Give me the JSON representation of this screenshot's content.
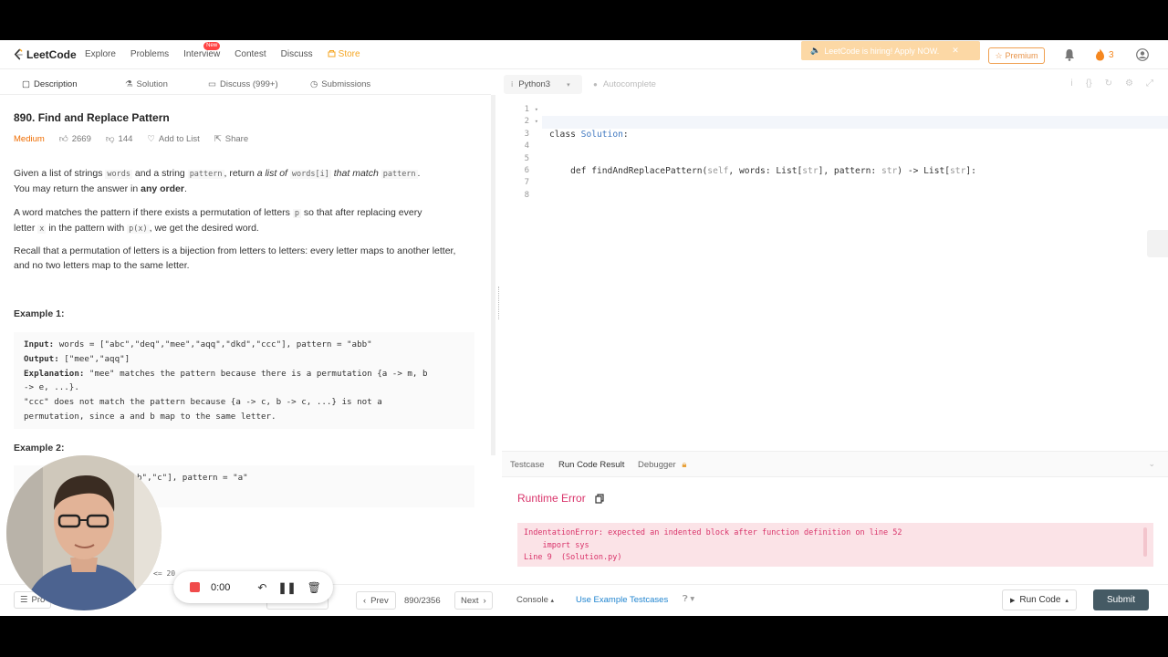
{
  "nav": {
    "logo": "LeetCode",
    "items": [
      "Explore",
      "Problems",
      "Interview",
      "Contest",
      "Discuss",
      "Store"
    ],
    "new_badge": "New",
    "hiring_banner": "LeetCode is hiring! Apply NOW.",
    "premium": "Premium",
    "streak": "3"
  },
  "left_tabs": {
    "description": "Description",
    "solution": "Solution",
    "discuss": "Discuss (999+)",
    "submissions": "Submissions"
  },
  "problem": {
    "title": "890. Find and Replace Pattern",
    "difficulty": "Medium",
    "likes": "2669",
    "dislikes": "144",
    "add_to_list": "Add to List",
    "share": "Share",
    "p1": {
      "a": "Given a list of strings",
      "b": "words",
      "c": "and a string",
      "d": "pattern",
      "e": ", return",
      "f": "a list of",
      "g": "words[i]",
      "h": "that match",
      "i": "pattern",
      "j": ".",
      "k": "You may return the answer in",
      "l": "any order",
      "m": "."
    },
    "p2": {
      "a": "A word matches the pattern if there exists a permutation of letters",
      "b": "p",
      "c": "so that after replacing every",
      "d": "letter",
      "e": "x",
      "f": "in the pattern with",
      "g": "p(x)",
      "h": ", we get the desired word."
    },
    "p3": "Recall that a permutation of letters is a bijection from letters to letters: every letter maps to another letter, and no two letters map to the same letter.",
    "example1_title": "Example 1:",
    "example1": {
      "input_label": "Input:",
      "input": " words = [\"abc\",\"deq\",\"mee\",\"aqq\",\"dkd\",\"ccc\"], pattern = \"abb\"",
      "output_label": "Output:",
      "output": " [\"mee\",\"aqq\"]",
      "explanation_label": "Explanation:",
      "explanation1": " \"mee\" matches the pattern because there is a permutation {a -> m, b",
      "explanation2": "-> e, ...}.",
      "explanation3": "\"ccc\" does not match the pattern because {a -> c, b -> c, ...} is not a",
      "explanation4": "permutation, since a and b map to the same letter."
    },
    "example2_title": "Example 2:",
    "example2_partial": "b\",\"c\"], pattern = \"a\"",
    "constraint_partial": "<= 20"
  },
  "left_bottom": {
    "problems_btn": "Pro",
    "prev": "Prev",
    "count": "890/2356",
    "next": "Next"
  },
  "editor": {
    "language": "Python3",
    "autocomplete": "Autocomplete",
    "line_numbers": [
      "1",
      "2",
      "3",
      "4",
      "5",
      "6",
      "7",
      "8"
    ],
    "line1_kw": "class",
    "line1_name": "Solution",
    "line1_end": ":",
    "line2_def": "    def",
    "line2_fn": "findAndReplacePattern",
    "line2_p1": "(",
    "line2_self": "self",
    "line2_p2": ", words: List[",
    "line2_str1": "str",
    "line2_p3": "], pattern:",
    "line2_str2": "str",
    "line2_p4": ") -> List[",
    "line2_str3": "str",
    "line2_p5": "]:"
  },
  "console": {
    "tabs": [
      "Testcase",
      "Run Code Result",
      "Debugger"
    ],
    "status": "Runtime Error",
    "error_lines": [
      "IndentationError: expected an indented block after function definition on line 52",
      "    import sys",
      "Line 9  (Solution.py)"
    ],
    "console_btn": "Console",
    "example_testcases": "Use Example Testcases",
    "run_code": "Run Code",
    "submit": "Submit"
  },
  "recorder": {
    "time": "0:00"
  },
  "colors": {
    "accent_orange": "#ef6c00",
    "error_pink": "#d9336a",
    "submit_bg": "#455a64",
    "link_blue": "#2185d0"
  }
}
